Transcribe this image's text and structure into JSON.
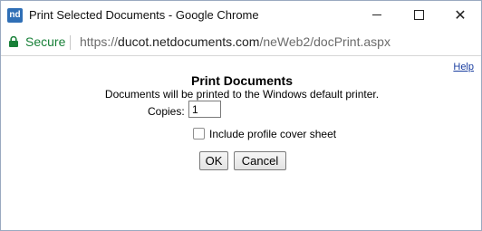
{
  "window": {
    "title": "Print Selected Documents - Google Chrome",
    "app_icon_text": "nd"
  },
  "address_bar": {
    "secure_label": "Secure",
    "url_prefix": "https://",
    "url_host": "ducot.netdocuments.com",
    "url_path": "/neWeb2/docPrint.aspx"
  },
  "page": {
    "help_link": "Help",
    "heading": "Print Documents",
    "subtitle": "Documents will be printed to the Windows default printer.",
    "copies_label": "Copies:",
    "copies_value": "1",
    "cover_sheet_label": "Include profile cover sheet",
    "cover_sheet_checked": false,
    "ok_button": "OK",
    "cancel_button": "Cancel"
  },
  "colors": {
    "secure_green": "#188038",
    "link_blue": "#1a3ea0"
  }
}
